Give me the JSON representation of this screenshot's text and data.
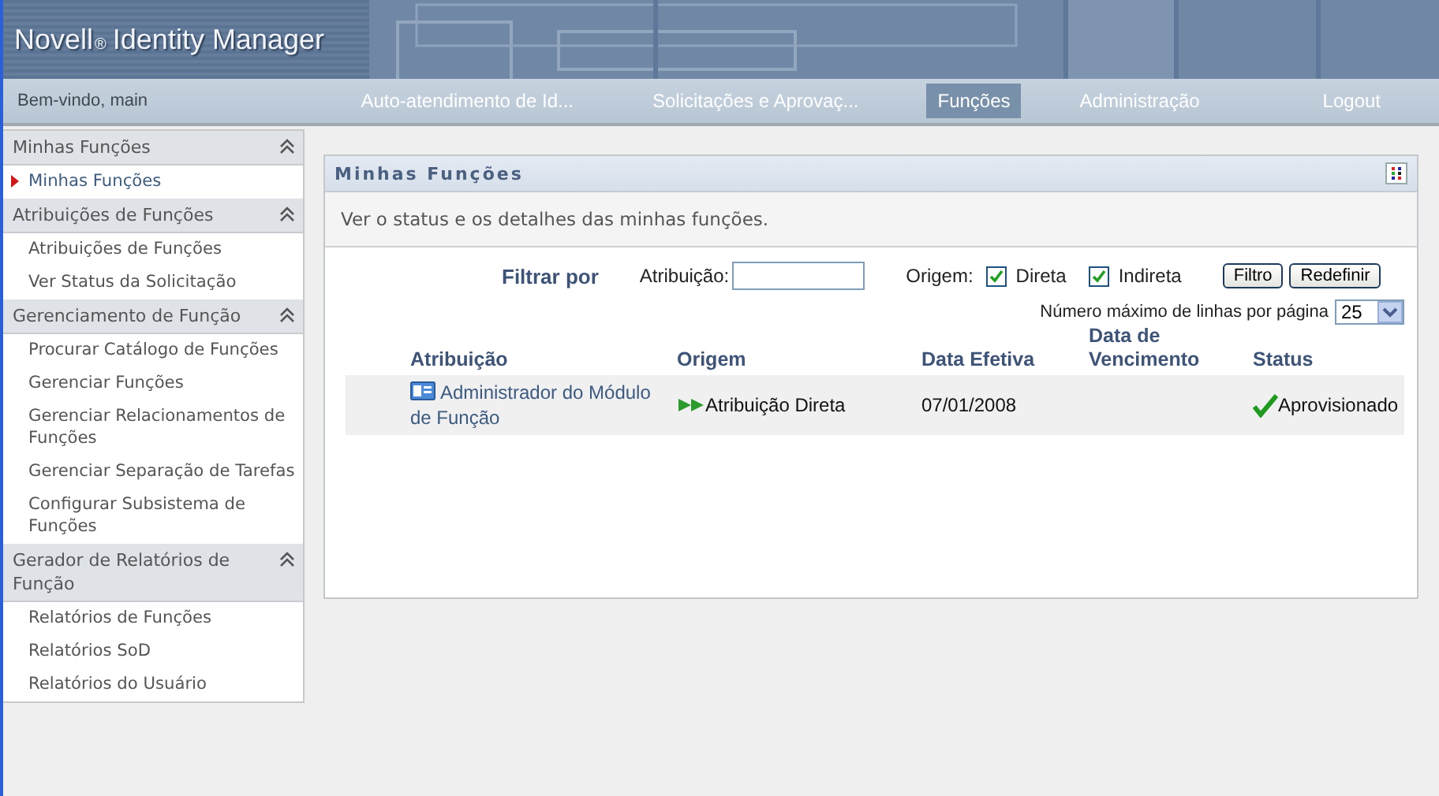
{
  "header": {
    "brand": "Novell",
    "brand_mark": "®",
    "product": "Identity Manager"
  },
  "welcome": "Bem-vindo, main",
  "nav": [
    {
      "label": "Auto-atendimento de Id...",
      "selected": false
    },
    {
      "label": "Solicitações e Aprovaç...",
      "selected": false
    },
    {
      "label": "Funções",
      "selected": true
    },
    {
      "label": "Administração",
      "selected": false
    },
    {
      "label": "Logout",
      "selected": false
    }
  ],
  "sidebar": [
    {
      "title": "Minhas Funções",
      "expanded": true,
      "items": [
        {
          "label": "Minhas Funções",
          "selected": true
        }
      ]
    },
    {
      "title": "Atribuições de Funções",
      "expanded": true,
      "items": [
        {
          "label": "Atribuições de Funções",
          "selected": false
        },
        {
          "label": "Ver Status da Solicitação",
          "selected": false
        }
      ]
    },
    {
      "title": "Gerenciamento de Função",
      "expanded": true,
      "items": [
        {
          "label": "Procurar Catálogo de Funções",
          "selected": false
        },
        {
          "label": "Gerenciar Funções",
          "selected": false
        },
        {
          "label": "Gerenciar Relacionamentos de Funções",
          "selected": false
        },
        {
          "label": "Gerenciar Separação de Tarefas",
          "selected": false
        },
        {
          "label": "Configurar Subsistema de Funções",
          "selected": false
        }
      ]
    },
    {
      "title": "Gerador de Relatórios de Função",
      "expanded": true,
      "items": [
        {
          "label": "Relatórios de Funções",
          "selected": false
        },
        {
          "label": "Relatórios SoD",
          "selected": false
        },
        {
          "label": "Relatórios do Usuário",
          "selected": false
        }
      ]
    }
  ],
  "panel": {
    "title": "Minhas Funções",
    "description": "Ver o status e os detalhes das minhas funções.",
    "filter": {
      "label": "Filtrar por",
      "assignment_label": "Atribuição:",
      "origin_label": "Origem:",
      "options": [
        {
          "label": "Direta",
          "checked": true
        },
        {
          "label": "Indireta",
          "checked": true
        }
      ],
      "buttons": [
        "Filtro",
        "Redefinir"
      ]
    },
    "rows_per_page": {
      "label": "Número máximo de linhas por página",
      "value": "25"
    },
    "table": {
      "columns": [
        "Atribuição",
        "Origem",
        "Data Efetiva",
        "Data de Vencimento",
        "Status"
      ],
      "rows": [
        {
          "assignment": "Administrador do Módulo de Função",
          "origin": "Atribuição Direta",
          "effective_date": "07/01/2008",
          "status": "Aprovisionado"
        }
      ]
    }
  }
}
